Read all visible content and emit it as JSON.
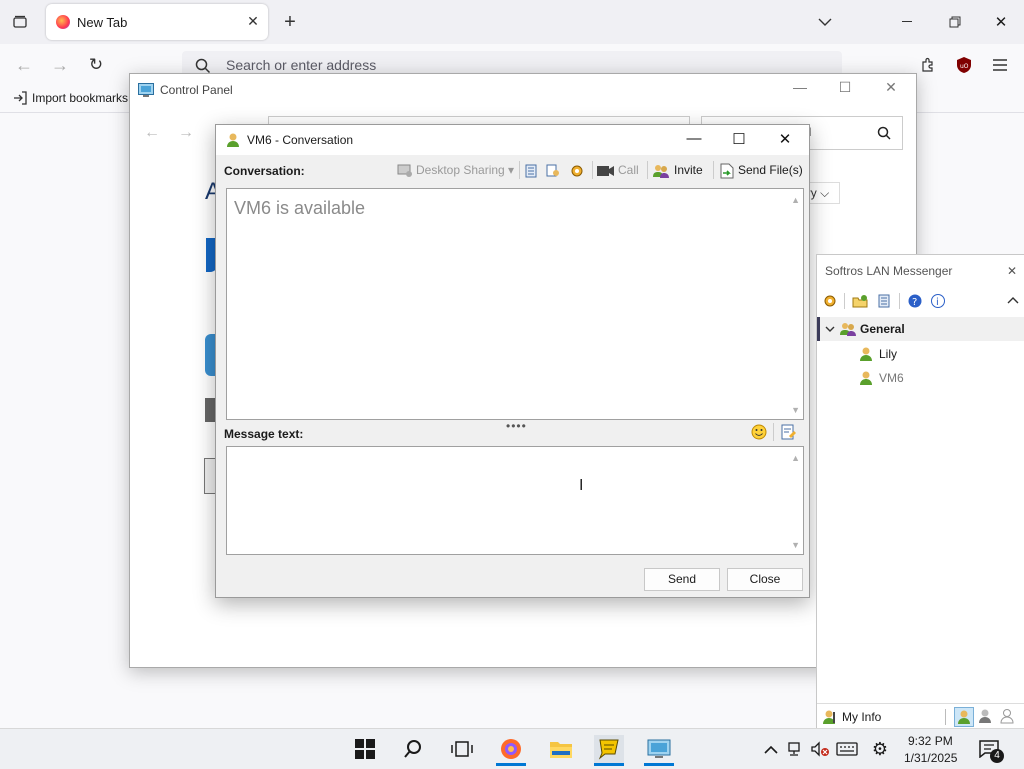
{
  "firefox": {
    "tab_title": "New Tab",
    "address_placeholder": "Search or enter address",
    "import_bookmarks": "Import bookmarks"
  },
  "control_panel": {
    "title": "Control Panel",
    "search_text": "el",
    "heading_partial": "A",
    "category_partial": "ry"
  },
  "conversation": {
    "title": "VM6 - Conversation",
    "conversation_label": "Conversation:",
    "toolbar": {
      "desktop_sharing": "Desktop Sharing",
      "call": "Call",
      "invite": "Invite",
      "send_files": "Send File(s)"
    },
    "status_text": "VM6 is available",
    "message_label": "Message text:",
    "message_value": "",
    "send": "Send",
    "close": "Close"
  },
  "messenger": {
    "title": "Softros LAN Messenger",
    "group": "General",
    "contacts": [
      {
        "name": "Lily",
        "online": true
      },
      {
        "name": "VM6",
        "online": true
      }
    ],
    "my_info": "My Info"
  },
  "taskbar": {
    "time": "9:32 PM",
    "date": "1/31/2025",
    "notifications": "4"
  },
  "colors": {
    "accent": "#0060df",
    "taskbar": "#eef0f3",
    "messenger_green": "#5aa02c"
  }
}
